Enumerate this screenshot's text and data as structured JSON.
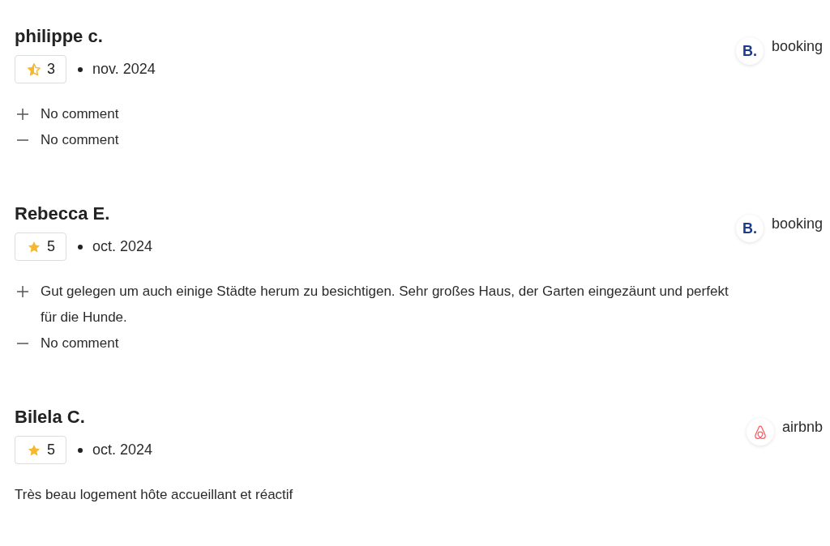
{
  "reviews": [
    {
      "author": "philippe c.",
      "rating": {
        "score": "3",
        "half_star": true
      },
      "date": "nov. 2024",
      "source": {
        "kind": "booking",
        "logo": "B.",
        "label": "booking"
      },
      "comments": [
        {
          "kind": "positive",
          "text": "No comment"
        },
        {
          "kind": "negative",
          "text": "No comment"
        }
      ]
    },
    {
      "author": "Rebecca E.",
      "rating": {
        "score": "5",
        "half_star": false
      },
      "date": "oct. 2024",
      "source": {
        "kind": "booking",
        "logo": "B.",
        "label": "booking"
      },
      "comments": [
        {
          "kind": "positive",
          "text": "Gut gelegen um auch einige Städte herum zu besichtigen. Sehr großes Haus, der Garten eingezäunt und perfekt für die Hunde."
        },
        {
          "kind": "negative",
          "text": "No comment"
        }
      ]
    },
    {
      "author": "Bilela C.",
      "rating": {
        "score": "5",
        "half_star": false
      },
      "date": "oct. 2024",
      "source": {
        "kind": "airbnb",
        "label": "airbnb"
      },
      "comments": [
        {
          "kind": "plain",
          "text": "Très beau logement hôte accueillant et réactif"
        }
      ]
    }
  ]
}
